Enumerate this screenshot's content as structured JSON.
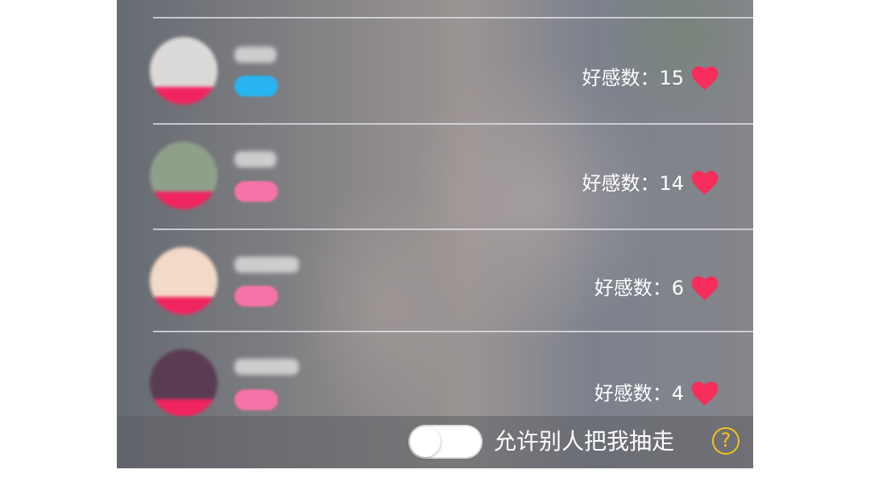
{
  "rows": [
    {
      "score_label": "好感数：15",
      "badge_color": "#28b4f0",
      "avatar_bg": "#dcdad8"
    },
    {
      "score_label": "好感数：14",
      "badge_color": "#f472a8",
      "avatar_bg": "#8fa08a"
    },
    {
      "score_label": "好感数：6",
      "badge_color": "#f472a8",
      "avatar_bg": "#f3d9c8"
    },
    {
      "score_label": "好感数：4",
      "badge_color": "#f472a8",
      "avatar_bg": "#5a3c52"
    }
  ],
  "footer": {
    "toggle_on": false,
    "label": "允许别人把我抽走",
    "help_symbol": "?"
  },
  "colors": {
    "heart": "#f72d5b",
    "accent_pink": "#f0245e",
    "help_yellow": "#f5c518"
  },
  "icons": [
    "heart-icon",
    "question-circle-icon",
    "toggle-switch"
  ]
}
